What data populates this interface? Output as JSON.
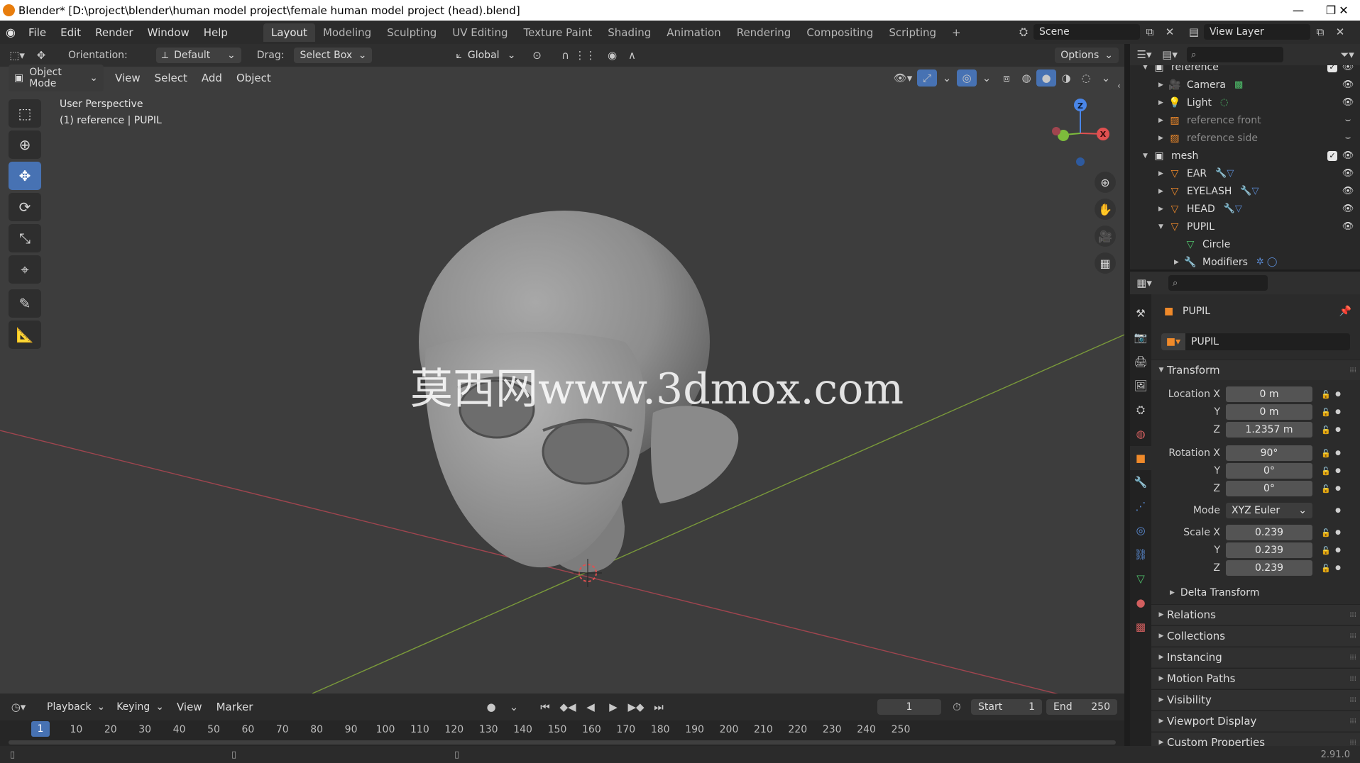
{
  "title_bar": {
    "title": "Blender* [D:\\project\\blender\\human model project\\female human model project (head).blend]",
    "minimize": "—",
    "maximize": "❐",
    "close": "✕"
  },
  "menu": [
    "File",
    "Edit",
    "Render",
    "Window",
    "Help"
  ],
  "workspaces": [
    "Layout",
    "Modeling",
    "Sculpting",
    "UV Editing",
    "Texture Paint",
    "Shading",
    "Animation",
    "Rendering",
    "Compositing",
    "Scripting",
    "+"
  ],
  "scene": {
    "name": "Scene",
    "view_layer": "View Layer"
  },
  "viewport_header": {
    "orientation_label": "Orientation:",
    "orientation_value": "Default",
    "drag_label": "Drag:",
    "drag_value": "Select Box",
    "transform_space": "Global",
    "options": "Options",
    "mode": "Object Mode",
    "view": "View",
    "select": "Select",
    "add": "Add",
    "object": "Object"
  },
  "viewport": {
    "perspective": "User Perspective",
    "context": "(1) reference | PUPIL",
    "watermark": "莫西网www.3dmox.com",
    "axis_z": "Z",
    "axis_x": "X",
    "colors": {
      "bg": "#3d3d3d",
      "x_axis": "#a0454f",
      "y_axis": "#7a9a3a",
      "accent": "#4772b3"
    }
  },
  "timeline": {
    "playback": "Playback",
    "keying": "Keying",
    "view": "View",
    "marker": "Marker",
    "current_frame": "1",
    "start_label": "Start",
    "start": "1",
    "end_label": "End",
    "end": "250",
    "ticks": [
      "10",
      "20",
      "30",
      "40",
      "50",
      "60",
      "70",
      "80",
      "90",
      "100",
      "110",
      "120",
      "130",
      "140",
      "150",
      "160",
      "170",
      "180",
      "190",
      "200",
      "210",
      "220",
      "230",
      "240",
      "250"
    ],
    "playhead": "1"
  },
  "status": {
    "version": "2.91.0"
  },
  "outliner": {
    "rows": [
      {
        "label": "reference",
        "indent": 0,
        "icon": "collection-icon",
        "expanded": true,
        "check": true
      },
      {
        "label": "Camera",
        "indent": 1,
        "icon": "camera-icon",
        "extra": "camera-data-icon"
      },
      {
        "label": "Light",
        "indent": 1,
        "icon": "light-icon",
        "extra": "light-data-icon"
      },
      {
        "label": "reference front",
        "indent": 1,
        "icon": "image-icon",
        "dim": true
      },
      {
        "label": "reference side",
        "indent": 1,
        "icon": "image-icon",
        "dim": true
      },
      {
        "label": "mesh",
        "indent": 0,
        "icon": "collection-icon",
        "expanded": true,
        "check": true
      },
      {
        "label": "EAR",
        "indent": 1,
        "icon": "mesh-object-icon",
        "extra": "modifier-wrench-icon"
      },
      {
        "label": "EYELASH",
        "indent": 1,
        "icon": "mesh-object-icon",
        "extra": "modifier-wrench-icon"
      },
      {
        "label": "HEAD",
        "indent": 1,
        "icon": "mesh-object-icon",
        "extra": "modifier-wrench-icon"
      },
      {
        "label": "PUPIL",
        "indent": 1,
        "icon": "mesh-object-icon",
        "expanded": true
      },
      {
        "label": "Circle",
        "indent": 2,
        "icon": "mesh-data-icon"
      },
      {
        "label": "Modifiers",
        "indent": 2,
        "icon": "modifier-wrench-icon",
        "extra": "modifier-stack-icon"
      }
    ]
  },
  "properties": {
    "object_name": "PUPIL",
    "data_name": "PUPIL",
    "transform_title": "Transform",
    "location_x_label": "Location X",
    "location": [
      "0 m",
      "0 m",
      "1.2357 m"
    ],
    "rotation_x_label": "Rotation X",
    "rotation": [
      "90°",
      "0°",
      "0°"
    ],
    "mode_label": "Mode",
    "mode_value": "XYZ Euler",
    "scale_x_label": "Scale X",
    "scale": [
      "0.239",
      "0.239",
      "0.239"
    ],
    "y_label": "Y",
    "z_label": "Z",
    "delta_transform": "Delta Transform",
    "sections": [
      "Relations",
      "Collections",
      "Instancing",
      "Motion Paths",
      "Visibility",
      "Viewport Display",
      "Custom Properties"
    ]
  }
}
